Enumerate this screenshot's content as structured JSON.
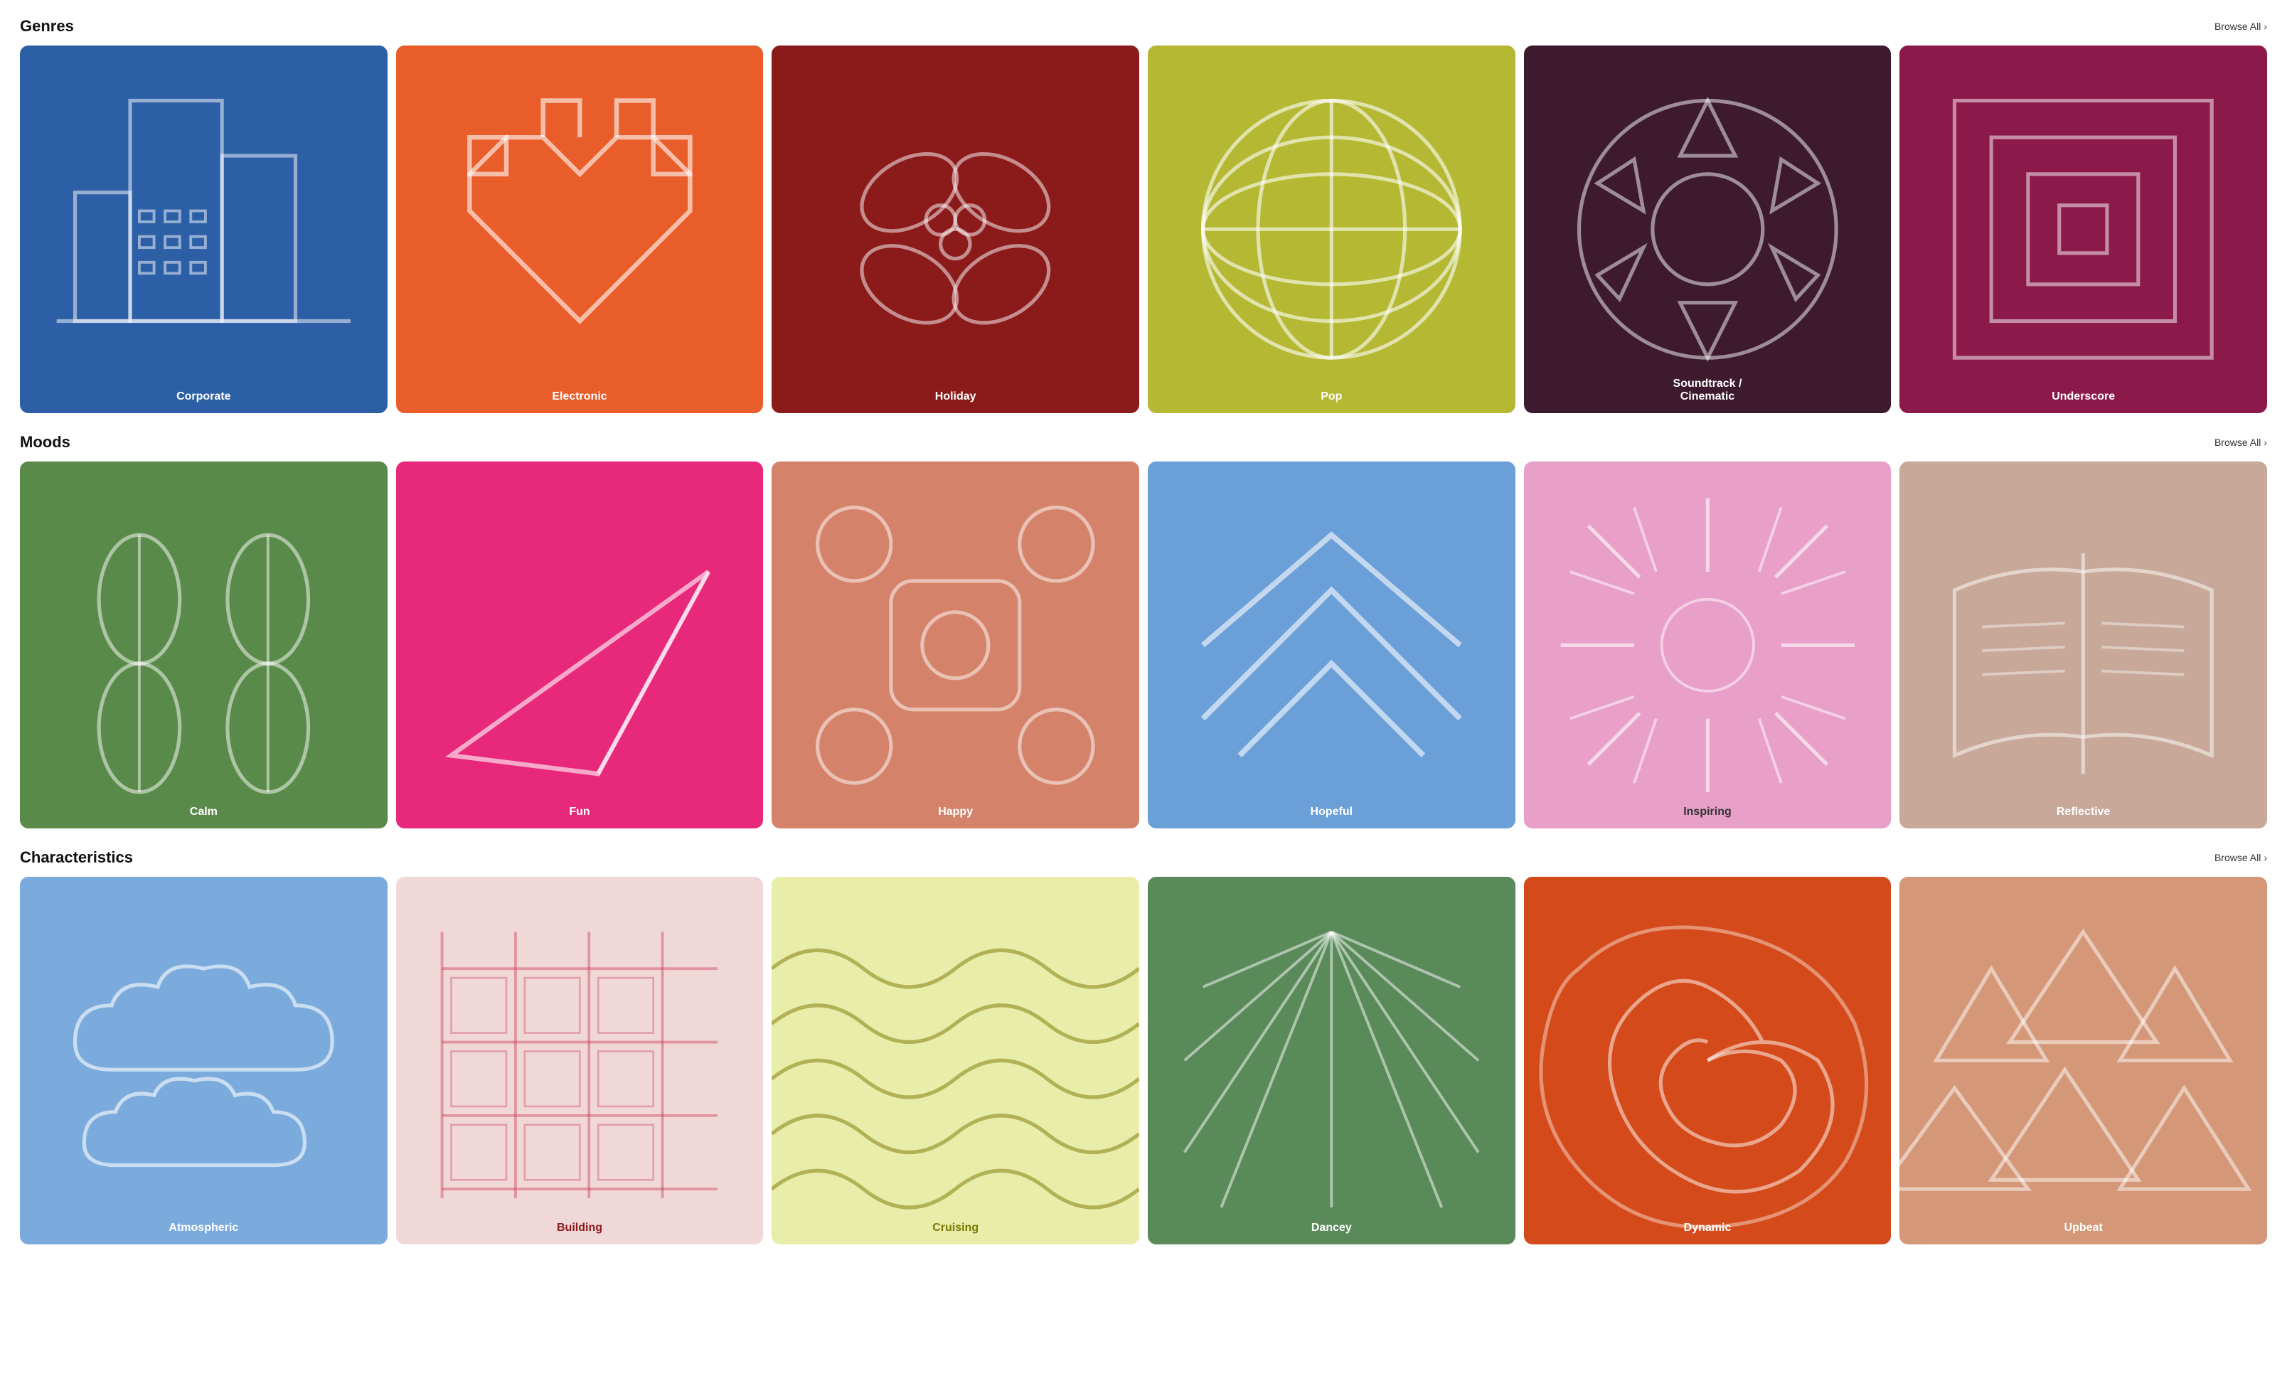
{
  "genres": {
    "title": "Genres",
    "browse_label": "Browse All",
    "cards": [
      {
        "id": "corporate",
        "label": "Corporate",
        "class": "card-corporate",
        "label_class": ""
      },
      {
        "id": "electronic",
        "label": "Electronic",
        "class": "card-electronic",
        "label_class": ""
      },
      {
        "id": "holiday",
        "label": "Holiday",
        "class": "card-holiday",
        "label_class": ""
      },
      {
        "id": "pop",
        "label": "Pop",
        "class": "card-pop",
        "label_class": ""
      },
      {
        "id": "soundtrack",
        "label": "Soundtrack /\nCinematic",
        "class": "card-soundtrack",
        "label_class": ""
      },
      {
        "id": "underscore",
        "label": "Underscore",
        "class": "card-underscore",
        "label_class": ""
      }
    ]
  },
  "moods": {
    "title": "Moods",
    "browse_label": "Browse All",
    "cards": [
      {
        "id": "calm",
        "label": "Calm",
        "class": "card-calm",
        "label_class": ""
      },
      {
        "id": "fun",
        "label": "Fun",
        "class": "card-fun",
        "label_class": ""
      },
      {
        "id": "happy",
        "label": "Happy",
        "class": "card-happy",
        "label_class": ""
      },
      {
        "id": "hopeful",
        "label": "Hopeful",
        "class": "card-hopeful",
        "label_class": ""
      },
      {
        "id": "inspiring",
        "label": "Inspiring",
        "class": "card-inspiring",
        "label_class": ""
      },
      {
        "id": "reflective",
        "label": "Reflective",
        "class": "card-reflective",
        "label_class": ""
      }
    ]
  },
  "characteristics": {
    "title": "Characteristics",
    "browse_label": "Browse All",
    "cards": [
      {
        "id": "atmospheric",
        "label": "Atmospheric",
        "class": "card-atmospheric",
        "label_class": ""
      },
      {
        "id": "building",
        "label": "Building",
        "class": "card-building",
        "label_class": "dark"
      },
      {
        "id": "cruising",
        "label": "Cruising",
        "class": "card-cruising",
        "label_class": "olive"
      },
      {
        "id": "dancey",
        "label": "Dancey",
        "class": "card-dancey",
        "label_class": ""
      },
      {
        "id": "dynamic",
        "label": "Dynamic",
        "class": "card-dynamic",
        "label_class": ""
      },
      {
        "id": "upbeat",
        "label": "Upbeat",
        "class": "card-upbeat",
        "label_class": ""
      }
    ]
  }
}
